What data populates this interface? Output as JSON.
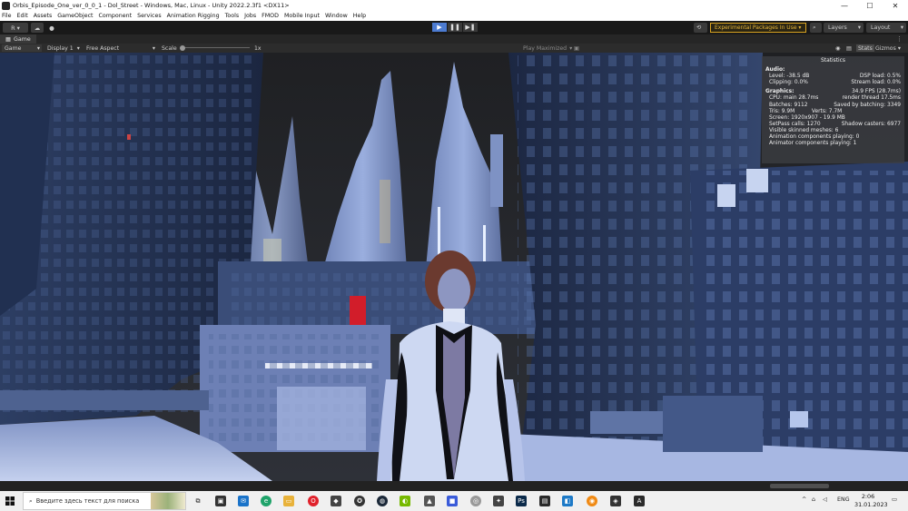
{
  "window": {
    "title": "Orbis_Episode_One_ver_0_0_1 - Dol_Street - Windows, Mac, Linux - Unity 2022.2.3f1 <DX11>",
    "minimize": "—",
    "maximize": "☐",
    "close": "✕"
  },
  "menu": [
    "File",
    "Edit",
    "Assets",
    "GameObject",
    "Component",
    "Services",
    "Animation Rigging",
    "Tools",
    "Jobs",
    "FMOD",
    "Mobile Input",
    "Window",
    "Help"
  ],
  "toolbar": {
    "account": "R",
    "play": "▶",
    "pause": "❚❚",
    "step": "▶❚",
    "experimental": "Experimental Packages In Use ▾",
    "layers": "Layers",
    "layout": "Layout"
  },
  "tab": {
    "game_label": "Game"
  },
  "gamebar": {
    "mode": "Game",
    "display": "Display 1",
    "aspect": "Free Aspect",
    "scale_label": "Scale",
    "scale_value": "1x",
    "play_maximized": "Play Maximized",
    "stats": "Stats",
    "gizmos": "Gizmos"
  },
  "stats": {
    "title": "Statistics",
    "audio_header": "Audio:",
    "level": "Level: -38.5 dB",
    "dsp": "DSP load: 0.5%",
    "clipping": "Clipping: 0.0%",
    "stream": "Stream load: 0.0%",
    "graphics_header": "Graphics:",
    "fps": "34.9 FPS (28.7ms)",
    "cpu": "CPU: main 28.7ms",
    "render_thread": "render thread 17.5ms",
    "batches": "Batches: 9112",
    "saved": "Saved by batching: 3349",
    "tris": "Tris: 9.9M",
    "verts": "Verts: 7.7M",
    "screen": "Screen: 1920x907 - 19.9 MB",
    "setpass": "SetPass calls: 1270",
    "shadow": "Shadow casters: 6977",
    "skinned": "Visible skinned meshes: 6",
    "anim": "Animation components playing: 0",
    "animator": "Animator components playing: 1"
  },
  "taskbar": {
    "search_placeholder": "Введите здесь текст для поиска",
    "lang": "ENG",
    "time": "2:06",
    "date": "31.01.2023",
    "tray_arrow": "^"
  },
  "colors": {
    "accent_play": "#4c7bd1",
    "warning": "#e6b53a"
  }
}
